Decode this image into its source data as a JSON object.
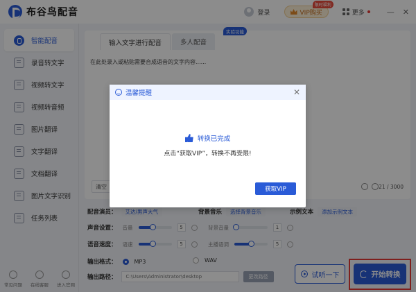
{
  "app": {
    "title": "布谷鸟配音",
    "login_label": "登录",
    "vip_label": "VIP购买",
    "vip_badge": "限时福利",
    "more_label": "更多",
    "window_controls": [
      "—",
      "✕"
    ]
  },
  "sidebar": {
    "items": [
      {
        "label": "智能配音",
        "active": true
      },
      {
        "label": "录音转文字"
      },
      {
        "label": "视频转文字"
      },
      {
        "label": "视频转音频"
      },
      {
        "label": "图片翻译"
      },
      {
        "label": "文字翻译"
      },
      {
        "label": "文档翻译"
      },
      {
        "label": "图片文字识别"
      },
      {
        "label": "任务列表"
      }
    ],
    "bottom": [
      {
        "label": "常见问题"
      },
      {
        "label": "在线客服"
      },
      {
        "label": "进入官网"
      }
    ]
  },
  "main": {
    "tabs": [
      {
        "label": "输入文字进行配音"
      },
      {
        "label": "多人配音"
      }
    ],
    "experiment_badge": "实验功能",
    "text_placeholder": "在此处录入或粘贴需要合成语音的文字内容......",
    "clear_label": "清空",
    "counter": "21 / 3000"
  },
  "settings": {
    "voice_label": "配音演员：",
    "voice_value": "艾达/男声大气",
    "bgm_label": "背景音乐",
    "bgm_value": "选择背景音乐",
    "example_label": "示例文本",
    "example_value": "添加示例文本",
    "sound_label": "声音设置：",
    "volume_label": "音量",
    "volume_value": "5",
    "bg_volume_label": "背景音量",
    "bg_volume_value": "1",
    "speed_label": "语音速度：",
    "speed_sub_label": "语速",
    "speed_value": "5",
    "pitch_label": "主播语调",
    "pitch_value": "5",
    "format_label": "输出格式：",
    "format_mp3": "MP3",
    "format_wav": "WAV",
    "path_label": "输出路径：",
    "path_value": "C:\\Users\\Administrator\\desktop",
    "change_path": "更改路径"
  },
  "actions": {
    "listen_label": "试听一下",
    "start_label": "开始转换"
  },
  "dialog": {
    "title": "温馨提醒",
    "done_text": "转换已完成",
    "message": "点击“获取VIP”，转换不再受限!",
    "vip_button": "获取VIP"
  },
  "colors": {
    "accent": "#2a5bd7",
    "highlight": "#e53935"
  }
}
